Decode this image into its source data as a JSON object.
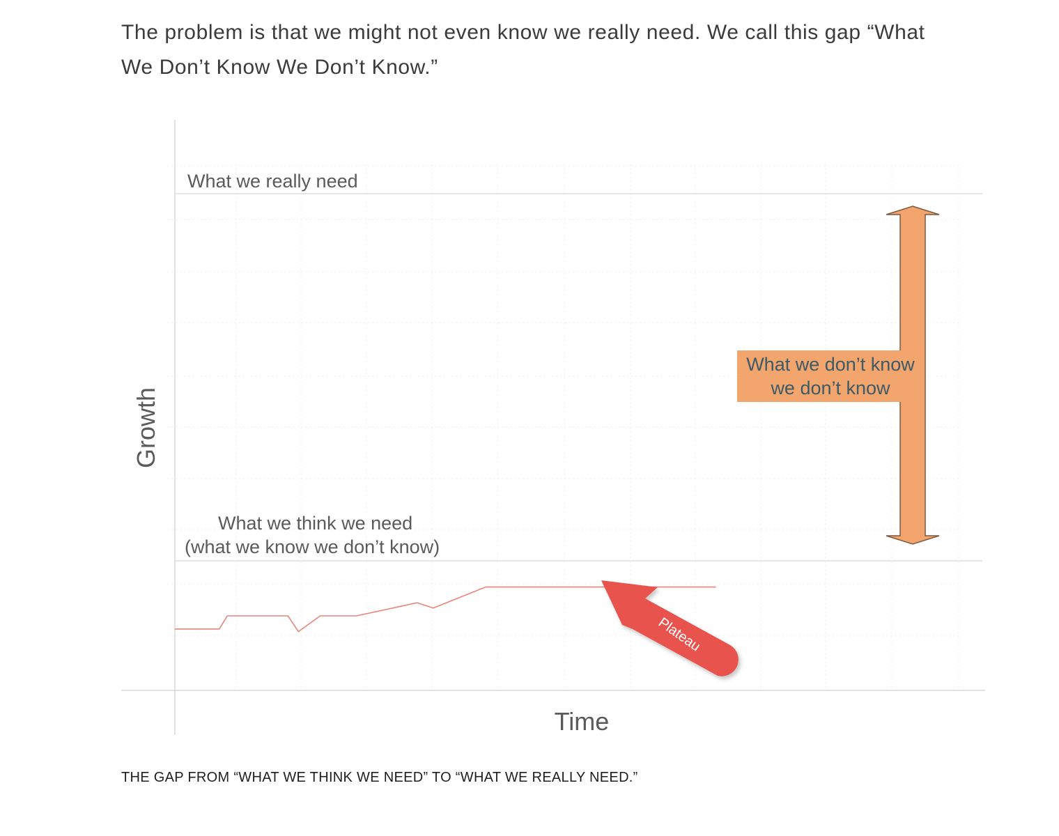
{
  "article": {
    "intro_line1": "The problem is that we might not even know we really need. We call this gap “What",
    "intro_line2": "We Don’t Know We Don’t Know.”",
    "caption": "THE GAP FROM “WHAT WE THINK WE NEED” TO “WHAT WE REALLY NEED.”"
  },
  "chart_data": {
    "type": "line",
    "title": "",
    "xlabel": "Time",
    "ylabel": "Growth",
    "xlim": [
      0,
      100
    ],
    "ylim": [
      0,
      100
    ],
    "grid": true,
    "series": [
      {
        "color": "#e8847a",
        "x": [
          0,
          5.5,
          6.5,
          14,
          15.3,
          18,
          22.5,
          30,
          32,
          38.5,
          56.5,
          60,
          60.9,
          67
        ],
        "y": [
          17,
          17,
          19.5,
          19.5,
          16.5,
          19.5,
          19.5,
          22,
          21,
          25,
          25,
          25,
          25,
          25
        ]
      }
    ],
    "reference_lines": [
      {
        "y": 100,
        "label": "What we really need"
      },
      {
        "y": 30,
        "label_line1": "What we think we need",
        "label_line2": "(what we know we don’t know)"
      }
    ],
    "annotations": {
      "gap_label_line1": "What we don’t know",
      "gap_label_line2": "we don’t know",
      "plateau_label": "Plateau"
    },
    "colors": {
      "gap_arrow": "#f2a46c",
      "gap_box": "#f2a66e",
      "gap_text": "#3d5a66",
      "plateau_arrow": "#e8534d",
      "series_line": "#e8847a",
      "axis": "#d0d0d0",
      "grid": "#f0f0f0"
    }
  }
}
